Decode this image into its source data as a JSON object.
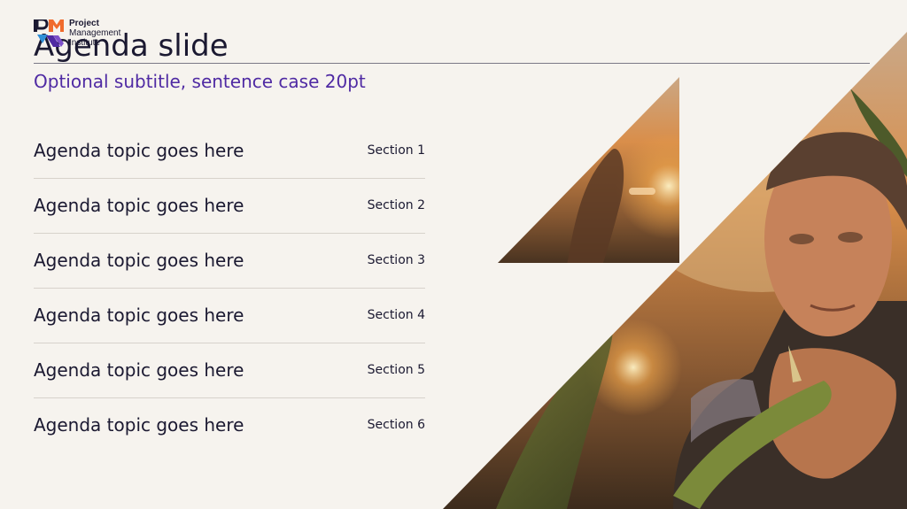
{
  "brand": {
    "name_line1": "Project",
    "name_line2": "Management",
    "name_line3": "Institute",
    "colors": {
      "orange": "#f06b2d",
      "purple": "#4f2aa3",
      "blue": "#2f8fd6",
      "navy": "#1b1931"
    }
  },
  "slide": {
    "title": "Agenda slide",
    "subtitle": "Optional subtitle, sentence case 20pt"
  },
  "agenda": {
    "items": [
      {
        "topic": "Agenda topic goes here",
        "section": "Section 1"
      },
      {
        "topic": "Agenda topic goes here",
        "section": "Section 2"
      },
      {
        "topic": "Agenda topic goes here",
        "section": "Section 3"
      },
      {
        "topic": "Agenda topic goes here",
        "section": "Section 4"
      },
      {
        "topic": "Agenda topic goes here",
        "section": "Section 5"
      },
      {
        "topic": "Agenda topic goes here",
        "section": "Section 6"
      }
    ]
  }
}
